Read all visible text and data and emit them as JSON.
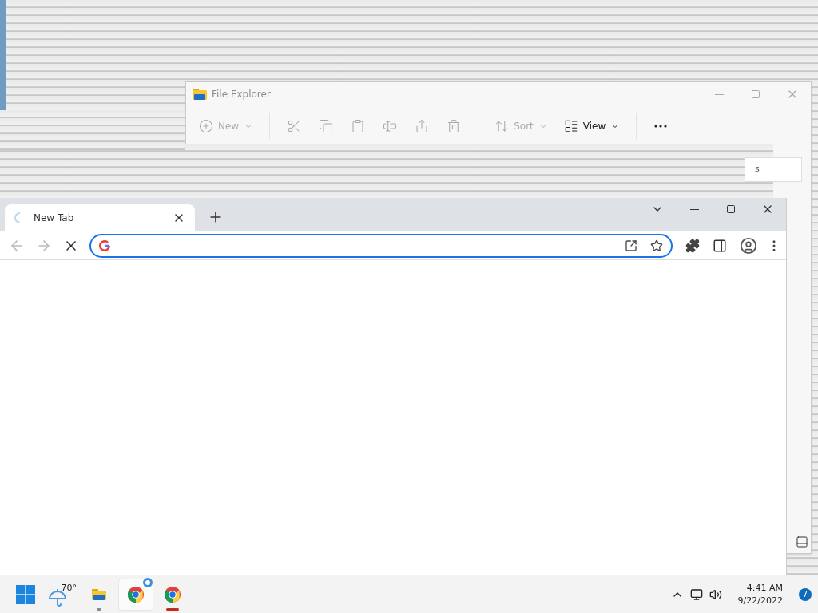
{
  "explorer": {
    "title": "File Explorer",
    "toolbar": [
      {
        "kind": "new",
        "label": "New",
        "dropdown": true
      },
      {
        "kind": "cut"
      },
      {
        "kind": "copy"
      },
      {
        "kind": "paste"
      },
      {
        "kind": "rename"
      },
      {
        "kind": "share"
      },
      {
        "kind": "delete"
      },
      {
        "kind": "sort",
        "label": "Sort",
        "dropdown": true
      },
      {
        "kind": "view",
        "label": "View",
        "dropdown": true
      },
      {
        "kind": "more"
      }
    ],
    "search_fragment": "s"
  },
  "browser": {
    "tabs": [
      {
        "title": "New Tab",
        "selected": true,
        "loading": true
      }
    ],
    "loading": true
  },
  "taskbar": {
    "apps": [
      {
        "kind": "start",
        "running": false,
        "active": false,
        "hovered": false
      },
      {
        "kind": "weather",
        "label": "70°",
        "running": false,
        "active": false,
        "hovered": false
      },
      {
        "kind": "explorer",
        "running": true,
        "active": false,
        "hovered": false
      },
      {
        "kind": "chrome",
        "running": false,
        "active": false,
        "hovered": true,
        "progress_ring": true
      },
      {
        "kind": "chrome",
        "running": true,
        "active": true,
        "hovered": false
      }
    ],
    "time": "4:41 AM",
    "date": "9/22/2022",
    "notifications": "7"
  }
}
